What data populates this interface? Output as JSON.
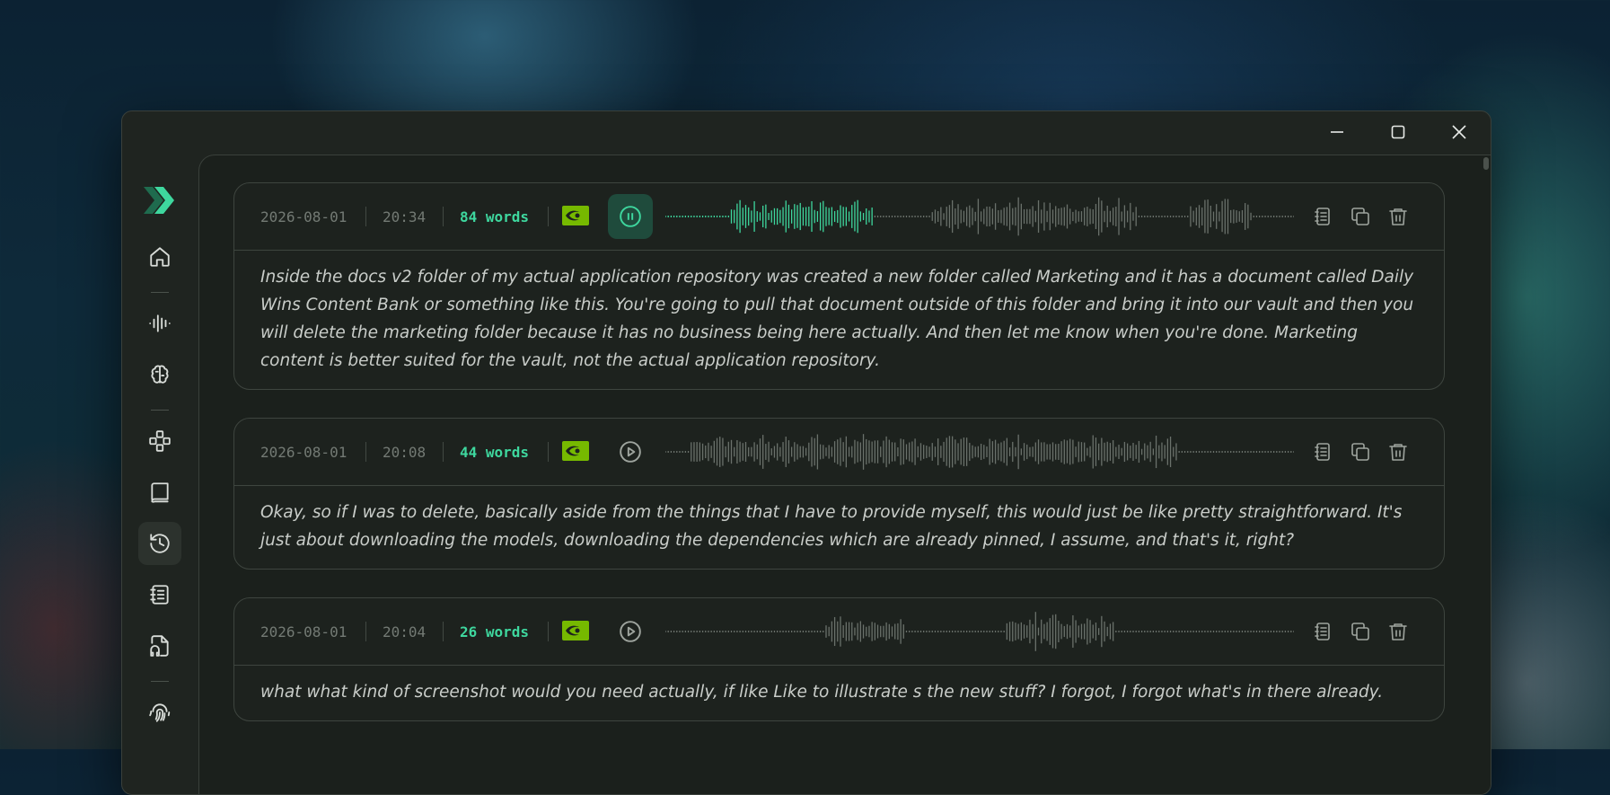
{
  "window": {
    "controls": {
      "minimize": "minimize-icon",
      "maximize": "maximize-icon",
      "close": "close-icon"
    }
  },
  "sidebar": {
    "logo_icon": "double-chevron-logo",
    "items": [
      {
        "icon": "home-icon",
        "active": false
      },
      {
        "icon": "audio-waveform-icon",
        "active": false
      },
      {
        "icon": "brain-icon",
        "active": false
      },
      {
        "icon": "gamepad-icon",
        "active": false
      },
      {
        "icon": "book-icon",
        "active": false
      },
      {
        "icon": "history-icon",
        "active": true
      },
      {
        "icon": "notebook-icon",
        "active": false
      },
      {
        "icon": "file-audio-icon",
        "active": false
      },
      {
        "icon": "fingerprint-icon",
        "active": false
      }
    ]
  },
  "colors": {
    "accent": "#3ed79e",
    "nvidia": "#76b900",
    "waveform_played": "#3ed79e",
    "waveform_unplayed": "#6a716b"
  },
  "entries": [
    {
      "date": "2026-08-01",
      "time": "20:34",
      "words": "84 words",
      "playing": true,
      "progress": 0.33,
      "text": "Inside the docs v2 folder of my actual application repository was created a new folder called Marketing and it has a document called Daily Wins Content Bank or something like this. You're going to pull that document outside of this folder and bring it into our vault and then you will delete the marketing folder because it has no business being here actually. And then let me know when you're done. Marketing content is better suited for the vault, not the actual application repository."
    },
    {
      "date": "2026-08-01",
      "time": "20:08",
      "words": "44 words",
      "playing": false,
      "progress": 0,
      "text": "Okay, so if I was to delete, basically aside from the things that I have to provide myself, this would just be like pretty straightforward. It's just about downloading the models, downloading the dependencies which are already pinned, I assume, and that's it, right?"
    },
    {
      "date": "2026-08-01",
      "time": "20:04",
      "words": "26 words",
      "playing": false,
      "progress": 0,
      "text": "what what kind of screenshot would you need actually, if like Like to illustrate s the new stuff? I forgot, I forgot what's in there already."
    }
  ],
  "entry_actions": {
    "transcript": "notebook-icon",
    "copy": "copy-icon",
    "delete": "trash-icon"
  }
}
